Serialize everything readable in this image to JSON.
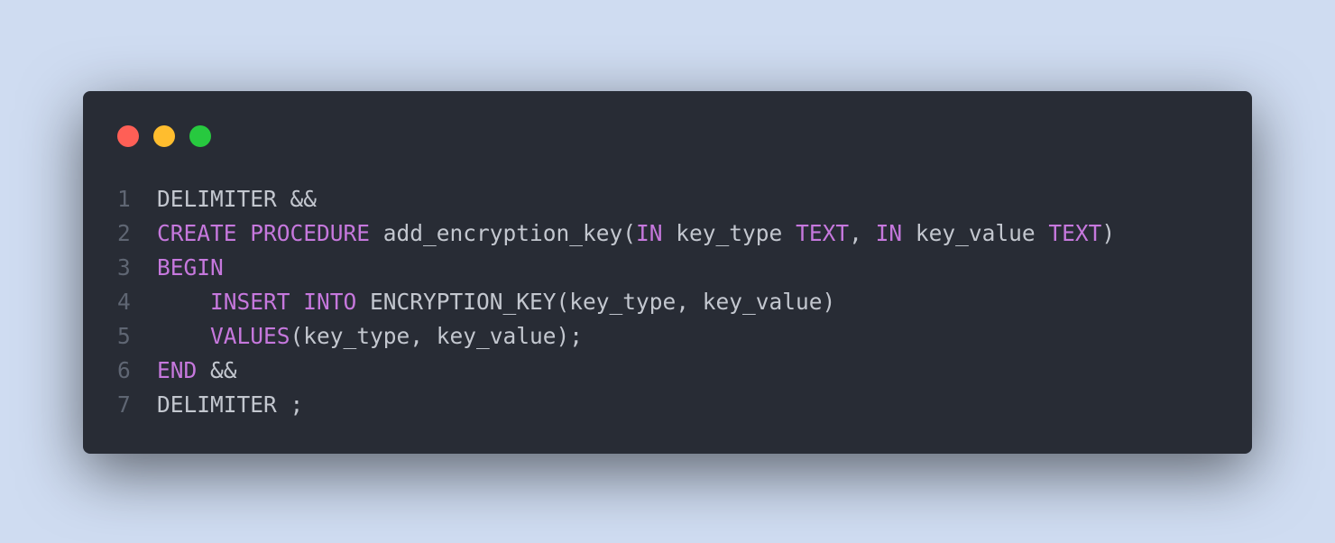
{
  "window": {
    "controls": [
      {
        "name": "close-button",
        "icon": "red-circle-icon",
        "color": "#ff5f56"
      },
      {
        "name": "minimize-button",
        "icon": "yellow-circle-icon",
        "color": "#ffbd2e"
      },
      {
        "name": "maximize-button",
        "icon": "green-circle-icon",
        "color": "#27c93f"
      }
    ]
  },
  "colors": {
    "background": "#cfdcf1",
    "window": "#282c35",
    "line_number": "#5f6673",
    "keyword": "#c678dd",
    "plain": "#c3c7cf"
  },
  "code": {
    "lines": [
      {
        "number": "1",
        "tokens": [
          {
            "text": "DELIMITER &&",
            "type": "plain"
          }
        ]
      },
      {
        "number": "2",
        "tokens": [
          {
            "text": "CREATE PROCEDURE",
            "type": "keyword"
          },
          {
            "text": " add_encryption_key(",
            "type": "plain"
          },
          {
            "text": "IN",
            "type": "keyword"
          },
          {
            "text": " key_type ",
            "type": "plain"
          },
          {
            "text": "TEXT",
            "type": "keyword"
          },
          {
            "text": ", ",
            "type": "plain"
          },
          {
            "text": "IN",
            "type": "keyword"
          },
          {
            "text": " key_value ",
            "type": "plain"
          },
          {
            "text": "TEXT",
            "type": "keyword"
          },
          {
            "text": ")",
            "type": "plain"
          }
        ]
      },
      {
        "number": "3",
        "tokens": [
          {
            "text": "BEGIN",
            "type": "keyword"
          }
        ]
      },
      {
        "number": "4",
        "tokens": [
          {
            "text": "    ",
            "type": "plain"
          },
          {
            "text": "INSERT INTO",
            "type": "keyword"
          },
          {
            "text": " ENCRYPTION_KEY(key_type, key_value)",
            "type": "plain"
          }
        ]
      },
      {
        "number": "5",
        "tokens": [
          {
            "text": "    ",
            "type": "plain"
          },
          {
            "text": "VALUES",
            "type": "keyword"
          },
          {
            "text": "(key_type, key_value);",
            "type": "plain"
          }
        ]
      },
      {
        "number": "6",
        "tokens": [
          {
            "text": "END",
            "type": "keyword"
          },
          {
            "text": " &&",
            "type": "plain"
          }
        ]
      },
      {
        "number": "7",
        "tokens": [
          {
            "text": "DELIMITER ;",
            "type": "plain"
          }
        ]
      }
    ]
  }
}
